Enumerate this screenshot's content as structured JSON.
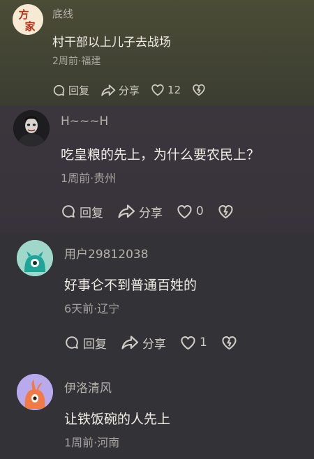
{
  "comments": [
    {
      "username": "底线",
      "avatar": {
        "type": "calligraphy",
        "text": "方家",
        "bg": "#f6ead5",
        "ink": "#b83216"
      },
      "content": "村干部以上儿子去战场",
      "meta": "2周前·福建",
      "actions": {
        "reply": "回复",
        "share": "分享",
        "like_count": "12"
      }
    },
    {
      "username": "H~~~H",
      "avatar": {
        "type": "photo",
        "bg": "#1d1c1f"
      },
      "content": "吃皇粮的先上，为什么要农民上？",
      "meta": "1周前·贵州",
      "actions": {
        "reply": "回复",
        "share": "分享",
        "like_count": "0"
      }
    },
    {
      "username": "用户29812038",
      "avatar": {
        "type": "default-mint",
        "bg": "#9fd8ca"
      },
      "content": "好事仑不到普通百姓的",
      "meta": "6天前·辽宁",
      "actions": {
        "reply": "回复",
        "share": "分享",
        "like_count": "1"
      }
    },
    {
      "username": "伊洛清风",
      "avatar": {
        "type": "default-lavender",
        "bg": "#b9aaee"
      },
      "content": "让铁饭碗的人先上",
      "meta": "1周前·河南"
    }
  ],
  "icons": {
    "reply": "comment-bubble-icon",
    "share": "share-arrow-icon",
    "like": "heart-icon",
    "dislike": "broken-heart-icon"
  },
  "colors": {
    "text_primary": "#f0ece6",
    "text_secondary": "#a7a39e",
    "icon": "#cfcbc5"
  }
}
